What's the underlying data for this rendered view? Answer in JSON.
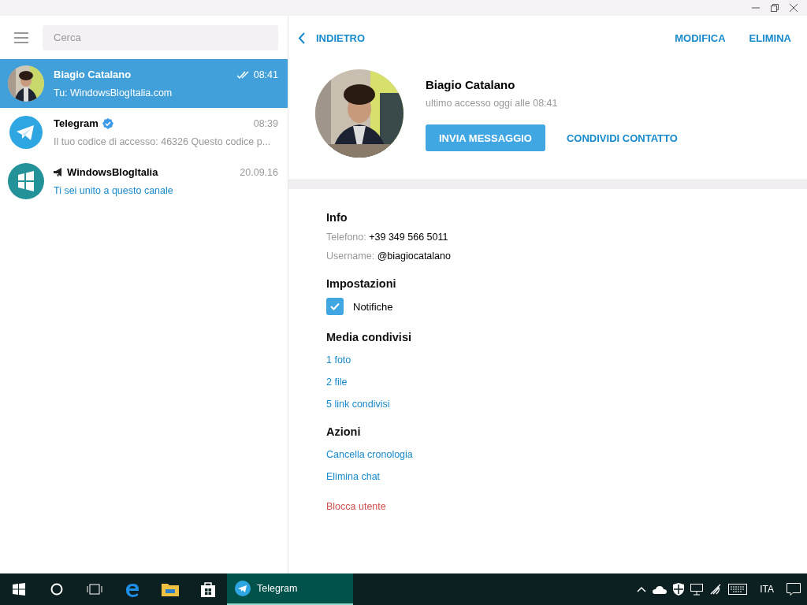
{
  "search": {
    "placeholder": "Cerca"
  },
  "chats": [
    {
      "kind": "user",
      "name": "Biagio Catalano",
      "time": "08:41",
      "preview": "Tu: WindowsBlogItalia.com",
      "selected": true,
      "read": true,
      "verified": false
    },
    {
      "kind": "bot",
      "name": "Telegram",
      "time": "08:39",
      "preview": "Il tuo codice di accesso: 46326  Questo codice p...",
      "selected": false,
      "read": false,
      "verified": true
    },
    {
      "kind": "channel",
      "name": "WindowsBlogItalia",
      "time": "20.09.16",
      "preview": "Ti sei unito a questo canale",
      "selected": false,
      "read": false,
      "verified": false
    }
  ],
  "topbar": {
    "back": "INDIETRO",
    "actions": [
      "MODIFICA",
      "ELIMINA"
    ]
  },
  "profile": {
    "name": "Biagio Catalano",
    "status": "ultimo accesso oggi alle 08:41",
    "primary_button": "INVIA MESSAGGIO",
    "secondary_button": "CONDIVIDI CONTATTO"
  },
  "sections": [
    {
      "kind": "info",
      "title": "Info",
      "rows": [
        {
          "label": "Telefono:",
          "value": "+39 349 566 5011"
        },
        {
          "label": "Username:",
          "value": "@biagiocatalano"
        }
      ]
    },
    {
      "kind": "settings",
      "title": "Impostazioni",
      "checkbox": {
        "label": "Notifiche",
        "checked": true
      }
    },
    {
      "kind": "links",
      "title": "Media condivisi",
      "links": [
        {
          "text": "1 foto",
          "kind": "link"
        },
        {
          "text": "2 file",
          "kind": "link"
        },
        {
          "text": "5 link condivisi",
          "kind": "link"
        }
      ]
    },
    {
      "kind": "links",
      "title": "Azioni",
      "links": [
        {
          "text": "Cancella cronologia",
          "kind": "link"
        },
        {
          "text": "Elimina chat",
          "kind": "link"
        },
        {
          "text": "Blocca utente",
          "kind": "danger"
        }
      ]
    }
  ],
  "taskbar": {
    "app": {
      "label": "Telegram",
      "selected": true
    },
    "language": "ITA"
  }
}
